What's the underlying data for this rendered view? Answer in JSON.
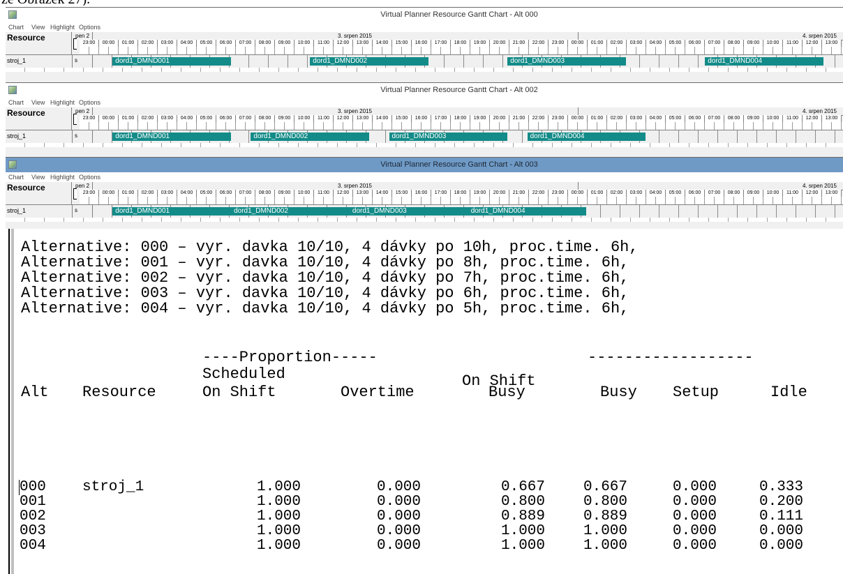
{
  "fragment": "ze Obrazek 27).",
  "gantt_windows": [
    {
      "title": "Virtual Planner Resource Gantt Chart - Alt 000",
      "active": false,
      "bars": [
        {
          "label": "dord1_DMND001",
          "start": 1,
          "end": 7
        },
        {
          "label": "dord1_DMND002",
          "start": 11,
          "end": 17
        },
        {
          "label": "dord1_DMND003",
          "start": 21,
          "end": 27
        },
        {
          "label": "dord1_DMND004",
          "start": 31,
          "end": 37
        }
      ]
    },
    {
      "title": "Virtual Planner Resource Gantt Chart - Alt 002",
      "active": false,
      "bars": [
        {
          "label": "dord1_DMND001",
          "start": 1,
          "end": 7
        },
        {
          "label": "dord1_DMND002",
          "start": 8,
          "end": 14
        },
        {
          "label": "dord1_DMND003",
          "start": 15,
          "end": 21
        },
        {
          "label": "dord1_DMND004",
          "start": 22,
          "end": 28
        }
      ]
    },
    {
      "title": "Virtual Planner Resource Gantt Chart - Alt 003",
      "active": true,
      "bars": [
        {
          "label": "dord1_DMND001",
          "start": 1,
          "end": 7
        },
        {
          "label": "dord1_DMND002",
          "start": 7,
          "end": 13
        },
        {
          "label": "dord1_DMND003",
          "start": 13,
          "end": 19
        },
        {
          "label": "dord1_DMND004",
          "start": 19,
          "end": 25
        }
      ]
    }
  ],
  "menu": {
    "chart": "Chart",
    "view": "View",
    "highlight": "Highlight",
    "options": "Options"
  },
  "gantt": {
    "resource_header": "Resource",
    "start_label": "pen 2",
    "day1": "3. srpen 2015",
    "day2": "4. srpen 2015",
    "hours": [
      "23:00",
      "00:00",
      "01:00",
      "02:00",
      "03:00",
      "04:00",
      "05:00",
      "06:00",
      "07:00",
      "08:00",
      "09:00",
      "10:00",
      "11:00",
      "12:00",
      "13:00",
      "14:00",
      "15:00",
      "16:00",
      "17:00",
      "18:00",
      "19:00",
      "20:00",
      "21:00",
      "22:00",
      "23:00",
      "00:00",
      "01:00",
      "02:00",
      "03:00",
      "04:00",
      "05:00",
      "06:00",
      "07:00",
      "08:00",
      "09:00",
      "10:00",
      "11:00",
      "12:00",
      "13:00"
    ],
    "resource": "stroj_1",
    "start_cell": "s"
  },
  "report": {
    "alternatives": [
      "Alternative: 000 – vyr. davka 10/10, 4 dávky po 10h, proc.time. 6h,",
      "Alternative: 001 – vyr. davka 10/10, 4 dávky po 8h, proc.time. 6h,",
      "Alternative: 002 – vyr. davka 10/10, 4 dávky po 7h, proc.time. 6h,",
      "Alternative: 003 – vyr. davka 10/10, 4 dávky po 6h, proc.time. 6h,",
      "Alternative: 004 – vyr. davka 10/10, 4 dávky po 5h, proc.time. 6h,"
    ],
    "proportion_header": "----Proportion-----",
    "dash_line": "------------------",
    "headers": {
      "scheduled": "Scheduled",
      "on_shift_top": "On Shift",
      "alt": "Alt",
      "resource": "Resource",
      "on_shift": "On Shift",
      "overtime": "Overtime",
      "busy_onshift": "Busy",
      "busy": "Busy",
      "setup": "Setup",
      "idle": "Idle"
    },
    "rows": [
      {
        "alt": "000",
        "resource": "stroj_1",
        "on_shift": "1.000",
        "overtime": "0.000",
        "on_shift_busy": "0.667",
        "busy": "0.667",
        "setup": "0.000",
        "idle": "0.333"
      },
      {
        "alt": "001",
        "resource": "",
        "on_shift": "1.000",
        "overtime": "0.000",
        "on_shift_busy": "0.800",
        "busy": "0.800",
        "setup": "0.000",
        "idle": "0.200"
      },
      {
        "alt": "002",
        "resource": "",
        "on_shift": "1.000",
        "overtime": "0.000",
        "on_shift_busy": "0.889",
        "busy": "0.889",
        "setup": "0.000",
        "idle": "0.111"
      },
      {
        "alt": "003",
        "resource": "",
        "on_shift": "1.000",
        "overtime": "0.000",
        "on_shift_busy": "1.000",
        "busy": "1.000",
        "setup": "0.000",
        "idle": "0.000"
      },
      {
        "alt": "004",
        "resource": "",
        "on_shift": "1.000",
        "overtime": "0.000",
        "on_shift_busy": "1.000",
        "busy": "1.000",
        "setup": "0.000",
        "idle": "0.000"
      }
    ]
  }
}
